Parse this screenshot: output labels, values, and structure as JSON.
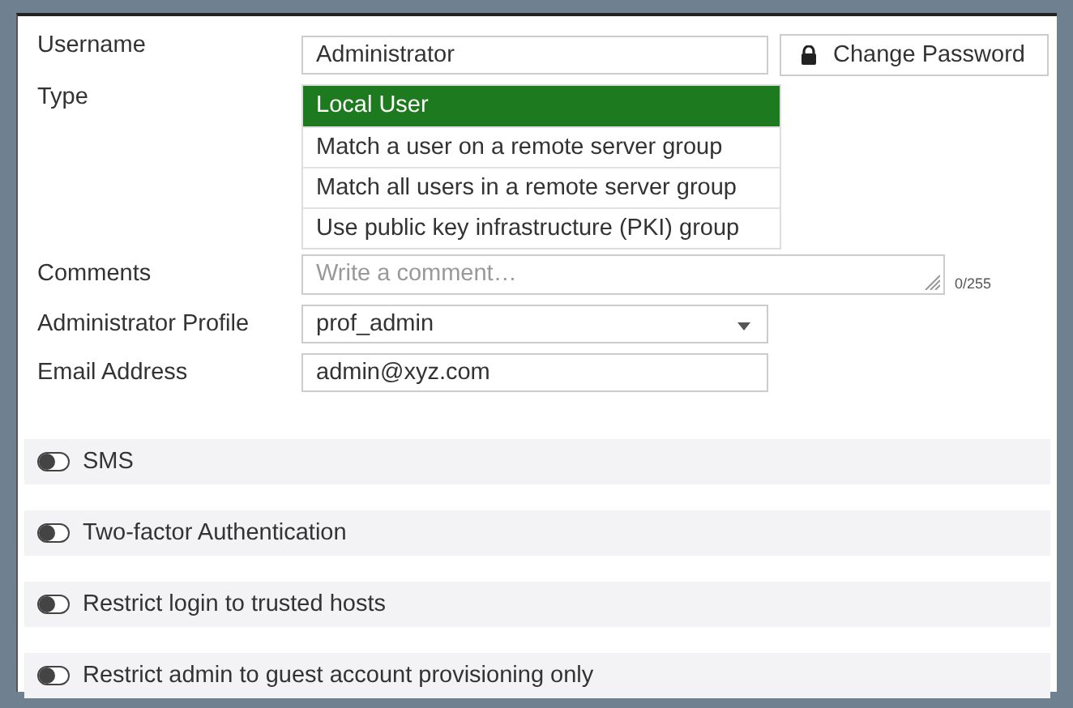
{
  "username": {
    "label": "Username",
    "value": "Administrator"
  },
  "change_password": {
    "label": "Change Password"
  },
  "type": {
    "label": "Type",
    "options": [
      {
        "label": "Local User",
        "selected": true
      },
      {
        "label": "Match a user on a remote server group",
        "selected": false
      },
      {
        "label": "Match all users in a remote server group",
        "selected": false
      },
      {
        "label": "Use public key infrastructure (PKI) group",
        "selected": false
      }
    ]
  },
  "comments": {
    "label": "Comments",
    "placeholder": "Write a comment…",
    "counter": "0/255"
  },
  "administrator_profile": {
    "label": "Administrator Profile",
    "value": "prof_admin"
  },
  "email": {
    "label": "Email Address",
    "value": "admin@xyz.com"
  },
  "toggles": [
    {
      "label": "SMS",
      "on": false
    },
    {
      "label": "Two-factor Authentication",
      "on": false
    },
    {
      "label": "Restrict login to trusted hosts",
      "on": false
    },
    {
      "label": "Restrict admin to guest account provisioning only",
      "on": false
    }
  ]
}
